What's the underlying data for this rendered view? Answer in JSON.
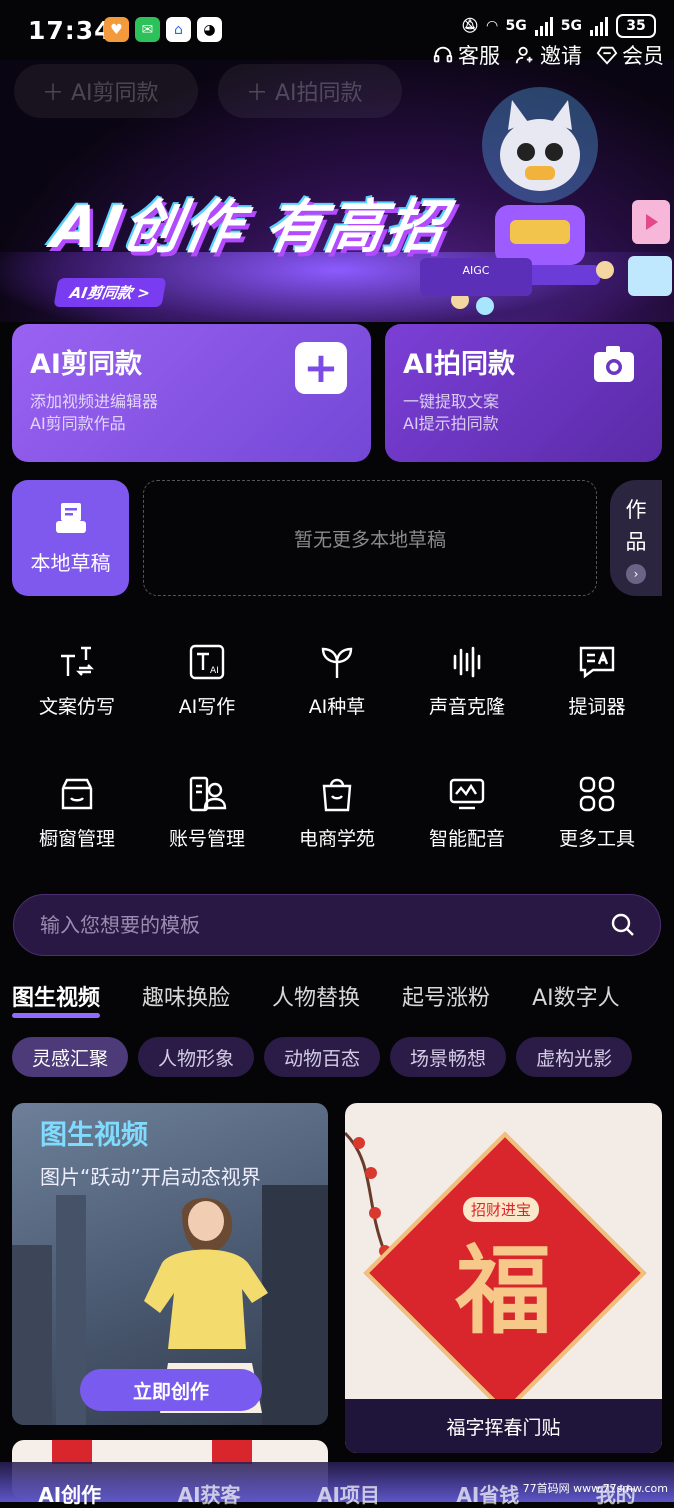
{
  "status_bar": {
    "time": "17:34",
    "network_a": "5G",
    "network_b": "5G",
    "battery": "35"
  },
  "top_links": [
    {
      "label": "客服",
      "icon": "headset-icon"
    },
    {
      "label": "邀请",
      "icon": "person-add-icon"
    },
    {
      "label": "会员",
      "icon": "diamond-icon"
    }
  ],
  "ghost_pills": [
    "＋ AI剪同款",
    "＋ AI拍同款"
  ],
  "banner": {
    "title": "AI创作 有高招",
    "tag": "AI剪同款 >",
    "platform_label": "AIGC"
  },
  "cards": {
    "cut": {
      "title": "AI剪同款",
      "line1": "添加视频进编辑器",
      "line2": "AI剪同款作品"
    },
    "shoot": {
      "title": "AI拍同款",
      "line1": "一键提取文案",
      "line2": "AI提示拍同款"
    }
  },
  "drafts": {
    "button": "本地草稿",
    "empty": "暂无更多本地草稿",
    "works_1": "作",
    "works_2": "品",
    "works_arrow": "›"
  },
  "tools": [
    {
      "label": "文案仿写",
      "icon": "text-rewrite-icon"
    },
    {
      "label": "AI写作",
      "icon": "ai-write-icon"
    },
    {
      "label": "AI种草",
      "icon": "sprout-icon"
    },
    {
      "label": "声音克隆",
      "icon": "voice-clone-icon"
    },
    {
      "label": "提词器",
      "icon": "teleprompter-icon"
    },
    {
      "label": "橱窗管理",
      "icon": "storefront-icon"
    },
    {
      "label": "账号管理",
      "icon": "account-icon"
    },
    {
      "label": "电商学苑",
      "icon": "shopping-bag-icon"
    },
    {
      "label": "智能配音",
      "icon": "smart-dubbing-icon"
    },
    {
      "label": "更多工具",
      "icon": "grid-icon"
    }
  ],
  "search": {
    "placeholder": "输入您想要的模板"
  },
  "category_tabs": [
    "图生视频",
    "趣味换脸",
    "人物替换",
    "起号涨粉",
    "AI数字人"
  ],
  "chips": [
    "灵感汇聚",
    "人物形象",
    "动物百态",
    "场景畅想",
    "虚构光影"
  ],
  "template_cards": {
    "card1": {
      "title": "图生视频",
      "subtitle": "图片“跃动”开启动态视界",
      "button": "立即创作"
    },
    "card2": {
      "top_label": "招财进宝",
      "big_char": "福",
      "caption": "福字挥春门贴"
    }
  },
  "bottom_nav": [
    "AI创作",
    "AI获客",
    "AI项目",
    "AI省钱",
    "我的"
  ],
  "watermark": "77首码网 www.77smw.com",
  "colors": {
    "accent": "#7f58ee",
    "card_purple": "#8a5ae8",
    "background": "#050507"
  }
}
